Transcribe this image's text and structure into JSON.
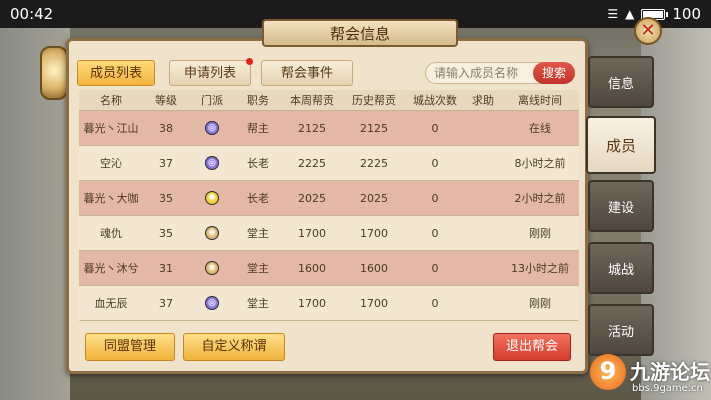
{
  "status_bar": {
    "time": "00:42",
    "battery": "100",
    "battery_level": 1.0
  },
  "window": {
    "title": "帮会信息"
  },
  "tabs": [
    {
      "label": "成员列表",
      "active": true
    },
    {
      "label": "申请列表",
      "has_notification": true
    },
    {
      "label": "帮会事件"
    }
  ],
  "search": {
    "placeholder": "请输入成员名称",
    "button": "搜索"
  },
  "table": {
    "headers": [
      "名称",
      "等级",
      "门派",
      "职务",
      "本周帮贡",
      "历史帮贡",
      "城战次数",
      "求助",
      "离线时间"
    ],
    "rows": [
      {
        "name": "暮光丶江山",
        "level": "38",
        "sect_icon": "purple-swirl-emblem",
        "role": "帮主",
        "week": "2125",
        "total": "2125",
        "wars": "0",
        "help": "",
        "offline": "在线"
      },
      {
        "name": "空沁",
        "level": "37",
        "sect_icon": "purple-swirl-emblem",
        "role": "长老",
        "week": "2225",
        "total": "2225",
        "wars": "0",
        "help": "",
        "offline": "8小时之前"
      },
      {
        "name": "暮光丶大咖",
        "level": "35",
        "sect_icon": "yellow-sun-emblem",
        "role": "长老",
        "week": "2025",
        "total": "2025",
        "wars": "0",
        "help": "",
        "offline": "2小时之前"
      },
      {
        "name": "魂仇",
        "level": "35",
        "sect_icon": "gold-lotus-emblem",
        "role": "堂主",
        "week": "1700",
        "total": "1700",
        "wars": "0",
        "help": "",
        "offline": "刚刚"
      },
      {
        "name": "暮光丶沐兮",
        "level": "31",
        "sect_icon": "gold-lotus-emblem",
        "role": "堂主",
        "week": "1600",
        "total": "1600",
        "wars": "0",
        "help": "",
        "offline": "13小时之前"
      },
      {
        "name": "血无辰",
        "level": "37",
        "sect_icon": "purple-swirl-emblem",
        "role": "堂主",
        "week": "1700",
        "total": "1700",
        "wars": "0",
        "help": "",
        "offline": "刚刚"
      }
    ]
  },
  "buttons": {
    "alliance": "同盟管理",
    "custom_title": "自定义称谓",
    "leave": "退出帮会"
  },
  "side_tabs": [
    {
      "label": "信息"
    },
    {
      "label": "成员",
      "active": true
    },
    {
      "label": "建设"
    },
    {
      "label": "城战"
    },
    {
      "label": "活动"
    }
  ],
  "watermark": {
    "logo": "9",
    "title": "九游论坛",
    "url": "bbs.9game.cn"
  },
  "colors": {
    "accent_gold": "#f2b43e",
    "danger_red": "#d43c2b",
    "row_highlight": "#e3b8a6"
  }
}
